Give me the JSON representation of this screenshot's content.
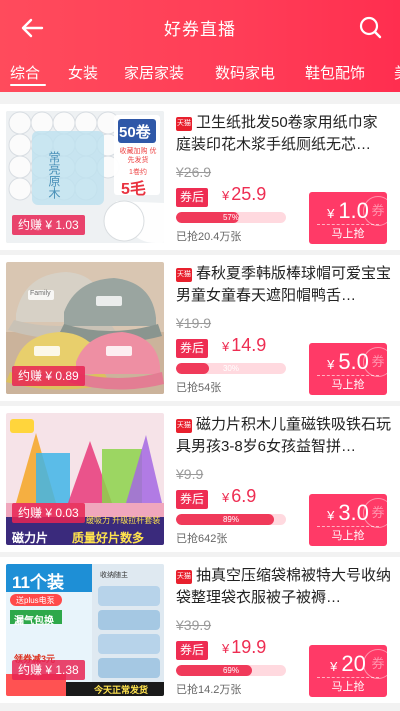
{
  "header": {
    "title": "好券直播",
    "back_icon": "arrow-left-icon",
    "search_icon": "search-icon"
  },
  "tabs": [
    {
      "label": "综合",
      "active": true
    },
    {
      "label": "女装",
      "active": false
    },
    {
      "label": "家居家装",
      "active": false
    },
    {
      "label": "数码家电",
      "active": false
    },
    {
      "label": "鞋包配饰",
      "active": false
    },
    {
      "label": "美",
      "active": false
    }
  ],
  "products": [
    {
      "store_badge": "天猫",
      "title": "卫生纸批发50卷家用纸巾家庭装印花木浆手纸厕纸无芯…",
      "original_price": "¥26.9",
      "after_label": "券后",
      "price_symbol": "¥",
      "price": "25.9",
      "claimed_percent": "57%",
      "claimed_fraction": 0.57,
      "sold": "已抢20.4万张",
      "coupon_symbol": "¥",
      "coupon_amount": "1.0",
      "grab_label": "马上抢",
      "earn": "约赚 ¥ 1.03",
      "thumb_text_1": "50卷",
      "thumb_text_2": "5毛",
      "thumb_text_3": "常亮原木",
      "thumb_text_4": "收藏加购 优先发货",
      "thumb_text_5": "1卷约"
    },
    {
      "store_badge": "天猫",
      "title": "春秋夏季韩版棒球帽可爱宝宝男童女童春天遮阳帽鸭舌…",
      "original_price": "¥19.9",
      "after_label": "券后",
      "price_symbol": "¥",
      "price": "14.9",
      "claimed_percent": "30%",
      "claimed_fraction": 0.3,
      "sold": "已抢54张",
      "coupon_symbol": "¥",
      "coupon_amount": "5.0",
      "grab_label": "马上抢",
      "earn": "约赚 ¥ 0.89",
      "thumb_text_1": "Family"
    },
    {
      "store_badge": "天猫",
      "title": "磁力片积木儿童磁铁吸铁石玩具男孩3-8岁6女孩益智拼…",
      "original_price": "¥9.9",
      "after_label": "券后",
      "price_symbol": "¥",
      "price": "6.9",
      "claimed_percent": "89%",
      "claimed_fraction": 0.89,
      "sold": "已抢642张",
      "coupon_symbol": "¥",
      "coupon_amount": "3.0",
      "grab_label": "马上抢",
      "earn": "约赚 ¥ 0.03",
      "thumb_text_1": "磁力片",
      "thumb_text_2": "质量好片数多",
      "thumb_text_3": "缓吸力 升级拉杆套装"
    },
    {
      "store_badge": "天猫",
      "title": "抽真空压缩袋棉被特大号收纳袋整理袋衣服被子被褥…",
      "original_price": "¥39.9",
      "after_label": "券后",
      "price_symbol": "¥",
      "price": "19.9",
      "claimed_percent": "69%",
      "claimed_fraction": 0.69,
      "sold": "已抢14.2万张",
      "coupon_symbol": "¥",
      "coupon_amount": "20",
      "grab_label": "马上抢",
      "earn": "约赚 ¥ 1.38",
      "thumb_text_1": "11个装",
      "thumb_text_2": "送plus电泵",
      "thumb_text_3": "漏气包换",
      "thumb_text_4": "领券减3元",
      "thumb_text_5": "今天正常发货",
      "thumb_text_6": "收纳随主"
    }
  ],
  "colors": {
    "accent": "#ee2d52",
    "header_start": "#ff4b5c",
    "header_end": "#ff2e4f",
    "coupon": "#ff3a67"
  }
}
